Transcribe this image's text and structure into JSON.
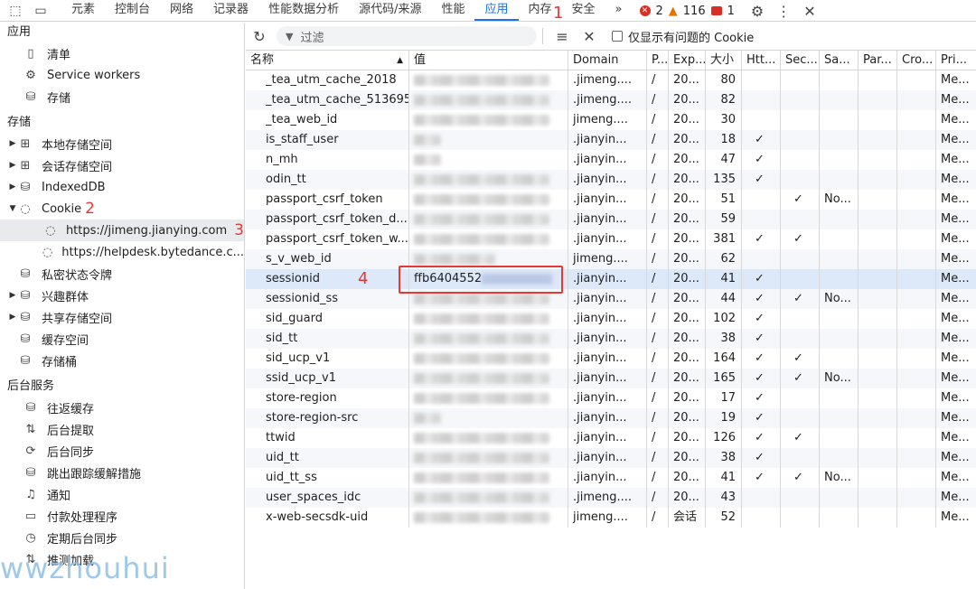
{
  "tabs": [
    "元素",
    "控制台",
    "网络",
    "记录器",
    "性能数据分析",
    "源代码/来源",
    "性能",
    "应用",
    "内存",
    "安全"
  ],
  "active_tab": "应用",
  "counts": {
    "errors": "2",
    "warnings": "116",
    "issues": "1"
  },
  "sidebar": {
    "sections": [
      {
        "title": "应用",
        "items": [
          {
            "label": "清单",
            "icon": "document-icon"
          },
          {
            "label": "Service workers",
            "icon": "gears-icon"
          },
          {
            "label": "存储",
            "icon": "database-icon"
          }
        ]
      },
      {
        "title": "存储",
        "items": [
          {
            "label": "本地存储空间",
            "icon": "grid-icon"
          },
          {
            "label": "会话存储空间",
            "icon": "grid-icon"
          },
          {
            "label": "IndexedDB",
            "icon": "database-icon"
          },
          {
            "label": "Cookie",
            "icon": "cookie-icon"
          },
          {
            "label": "https://jimeng.jianying.com",
            "icon": "cookie-icon"
          },
          {
            "label": "https://helpdesk.bytedance.c...",
            "icon": "cookie-icon"
          },
          {
            "label": "私密状态令牌",
            "icon": "database-icon"
          },
          {
            "label": "兴趣群体",
            "icon": "database-icon"
          },
          {
            "label": "共享存储空间",
            "icon": "database-icon"
          },
          {
            "label": "缓存空间",
            "icon": "database-icon"
          },
          {
            "label": "存储桶",
            "icon": "database-icon"
          }
        ]
      },
      {
        "title": "后台服务",
        "items": [
          {
            "label": "往返缓存",
            "icon": "database-icon"
          },
          {
            "label": "后台提取",
            "icon": "updown-icon"
          },
          {
            "label": "后台同步",
            "icon": "sync-icon"
          },
          {
            "label": "跳出跟踪缓解措施",
            "icon": "database-icon"
          },
          {
            "label": "通知",
            "icon": "bell-icon"
          },
          {
            "label": "付款处理程序",
            "icon": "card-icon"
          },
          {
            "label": "定期后台同步",
            "icon": "clock-icon"
          },
          {
            "label": "推测加载",
            "icon": "updown-icon"
          }
        ]
      }
    ]
  },
  "toolbar": {
    "filter_placeholder": "过滤",
    "only_issues_label": "仅显示有问题的 Cookie"
  },
  "table": {
    "headers": [
      "名称",
      "值",
      "Domain",
      "P...",
      "Exp...",
      "大小",
      "Htt...",
      "Sec...",
      "Sa...",
      "Par...",
      "Cro...",
      "Pri..."
    ],
    "rows": [
      {
        "name": "_tea_utm_cache_2018",
        "value": "",
        "domain": ".jimeng....",
        "path": "/",
        "exp": "20...",
        "size": "80",
        "http": "",
        "sec": "",
        "same": "",
        "pri": "Me..."
      },
      {
        "name": "_tea_utm_cache_513695",
        "value": "",
        "domain": ".jimeng....",
        "path": "/",
        "exp": "20...",
        "size": "82",
        "http": "",
        "sec": "",
        "same": "",
        "pri": "Me..."
      },
      {
        "name": "_tea_web_id",
        "value": "",
        "domain": "jimeng....",
        "path": "/",
        "exp": "20...",
        "size": "30",
        "http": "",
        "sec": "",
        "same": "",
        "pri": "Me..."
      },
      {
        "name": "is_staff_user",
        "value": "",
        "domain": ".jianyin...",
        "path": "/",
        "exp": "20...",
        "size": "18",
        "http": "✓",
        "sec": "",
        "same": "",
        "pri": "Me..."
      },
      {
        "name": "n_mh",
        "value": "",
        "domain": ".jianyin...",
        "path": "/",
        "exp": "20...",
        "size": "47",
        "http": "✓",
        "sec": "",
        "same": "",
        "pri": "Me..."
      },
      {
        "name": "odin_tt",
        "value": "",
        "domain": ".jianyin...",
        "path": "/",
        "exp": "20...",
        "size": "135",
        "http": "✓",
        "sec": "",
        "same": "",
        "pri": "Me..."
      },
      {
        "name": "passport_csrf_token",
        "value": "",
        "domain": ".jianyin...",
        "path": "/",
        "exp": "20...",
        "size": "51",
        "http": "",
        "sec": "✓",
        "same": "No...",
        "pri": "Me..."
      },
      {
        "name": "passport_csrf_token_d...",
        "value": "",
        "domain": ".jianyin...",
        "path": "/",
        "exp": "20...",
        "size": "59",
        "http": "",
        "sec": "",
        "same": "",
        "pri": "Me..."
      },
      {
        "name": "passport_csrf_token_w...",
        "value": "",
        "domain": ".jianyin...",
        "path": "/",
        "exp": "20...",
        "size": "381",
        "http": "✓",
        "sec": "✓",
        "same": "",
        "pri": "Me..."
      },
      {
        "name": "s_v_web_id",
        "value": "",
        "domain": "jimeng....",
        "path": "/",
        "exp": "20...",
        "size": "62",
        "http": "",
        "sec": "",
        "same": "",
        "pri": "Me..."
      },
      {
        "name": "sessionid",
        "value": "ffb6404552",
        "domain": ".jianyin...",
        "path": "/",
        "exp": "20...",
        "size": "41",
        "http": "✓",
        "sec": "",
        "same": "",
        "pri": "Me..."
      },
      {
        "name": "sessionid_ss",
        "value": "",
        "domain": ".jianyin...",
        "path": "/",
        "exp": "20...",
        "size": "44",
        "http": "✓",
        "sec": "✓",
        "same": "No...",
        "pri": "Me..."
      },
      {
        "name": "sid_guard",
        "value": "",
        "domain": ".jianyin...",
        "path": "/",
        "exp": "20...",
        "size": "102",
        "http": "✓",
        "sec": "",
        "same": "",
        "pri": "Me..."
      },
      {
        "name": "sid_tt",
        "value": "",
        "domain": ".jianyin...",
        "path": "/",
        "exp": "20...",
        "size": "38",
        "http": "✓",
        "sec": "",
        "same": "",
        "pri": "Me..."
      },
      {
        "name": "sid_ucp_v1",
        "value": "",
        "domain": ".jianyin...",
        "path": "/",
        "exp": "20...",
        "size": "164",
        "http": "✓",
        "sec": "✓",
        "same": "",
        "pri": "Me..."
      },
      {
        "name": "ssid_ucp_v1",
        "value": "",
        "domain": ".jianyin...",
        "path": "/",
        "exp": "20...",
        "size": "165",
        "http": "✓",
        "sec": "✓",
        "same": "No...",
        "pri": "Me..."
      },
      {
        "name": "store-region",
        "value": "",
        "domain": ".jianyin...",
        "path": "/",
        "exp": "20...",
        "size": "17",
        "http": "✓",
        "sec": "",
        "same": "",
        "pri": "Me..."
      },
      {
        "name": "store-region-src",
        "value": "",
        "domain": ".jianyin...",
        "path": "/",
        "exp": "20...",
        "size": "19",
        "http": "✓",
        "sec": "",
        "same": "",
        "pri": "Me..."
      },
      {
        "name": "ttwid",
        "value": "",
        "domain": ".jianyin...",
        "path": "/",
        "exp": "20...",
        "size": "126",
        "http": "✓",
        "sec": "✓",
        "same": "",
        "pri": "Me..."
      },
      {
        "name": "uid_tt",
        "value": "",
        "domain": ".jianyin...",
        "path": "/",
        "exp": "20...",
        "size": "38",
        "http": "✓",
        "sec": "",
        "same": "",
        "pri": "Me..."
      },
      {
        "name": "uid_tt_ss",
        "value": "",
        "domain": ".jianyin...",
        "path": "/",
        "exp": "20...",
        "size": "41",
        "http": "✓",
        "sec": "✓",
        "same": "No...",
        "pri": "Me..."
      },
      {
        "name": "user_spaces_idc",
        "value": "",
        "domain": ".jimeng....",
        "path": "/",
        "exp": "20...",
        "size": "43",
        "http": "",
        "sec": "",
        "same": "",
        "pri": "Me..."
      },
      {
        "name": "x-web-secsdk-uid",
        "value": "",
        "domain": "jimeng....",
        "path": "/",
        "exp": "会话",
        "size": "52",
        "http": "",
        "sec": "",
        "same": "",
        "pri": "Me..."
      }
    ]
  },
  "annotations": [
    "1",
    "2",
    "3",
    "4"
  ],
  "watermark": "wwzhouhui"
}
